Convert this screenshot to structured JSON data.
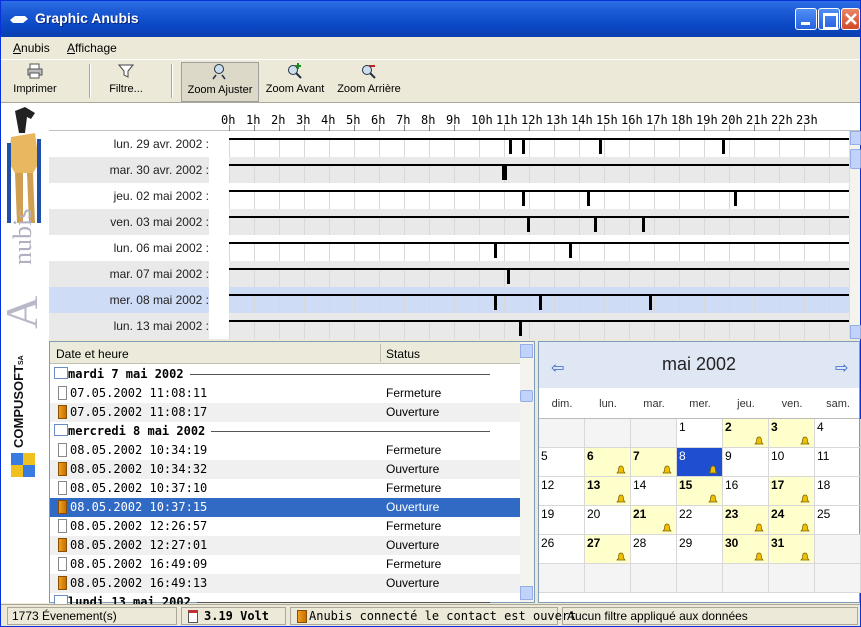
{
  "window": {
    "title": "Graphic Anubis"
  },
  "menu": {
    "anubis": "Anubis",
    "affichage": "Affichage"
  },
  "toolbar": {
    "print": "Imprimer",
    "filter": "Filtre...",
    "zoom_fit": "Zoom Ajuster",
    "zoom_in": "Zoom Avant",
    "zoom_out": "Zoom Arrière"
  },
  "banner": {
    "brand": "nubis",
    "brand_initial": "A",
    "company": "COMPUSOFT",
    "company_suffix": "SA"
  },
  "timeline": {
    "hours": [
      "0h",
      "1h",
      "2h",
      "3h",
      "4h",
      "5h",
      "6h",
      "7h",
      "8h",
      "9h",
      "10h",
      "11h",
      "12h",
      "13h",
      "14h",
      "15h",
      "16h",
      "17h",
      "18h",
      "19h",
      "20h",
      "21h",
      "22h",
      "23h"
    ],
    "rows": [
      {
        "date": "lun. 29 avr. 2002 :",
        "events": [
          11.2,
          11.7,
          14.8,
          19.7
        ]
      },
      {
        "date": "mar. 30 avr. 2002 :",
        "events": [
          10.9,
          11.0
        ]
      },
      {
        "date": "jeu. 02 mai 2002 :",
        "events": [
          11.7,
          14.3,
          20.2
        ]
      },
      {
        "date": "ven. 03 mai 2002 :",
        "events": [
          11.9,
          14.6,
          16.5
        ]
      },
      {
        "date": "lun. 06 mai 2002 :",
        "events": [
          10.6,
          13.6
        ]
      },
      {
        "date": "mar. 07 mai 2002 :",
        "events": [
          11.1
        ]
      },
      {
        "date": "mer. 08 mai 2002 :",
        "events": [
          10.6,
          12.4,
          16.8
        ]
      },
      {
        "date": "lun. 13 mai 2002 :",
        "events": [
          11.6
        ]
      }
    ],
    "selected_row": 6
  },
  "events": {
    "col_date": "Date et heure",
    "col_status": "Status",
    "rows": [
      {
        "type": "group",
        "text": "mardi 7 mai 2002"
      },
      {
        "type": "item",
        "icon": "closed",
        "text": "07.05.2002 11:08:11",
        "status": "Fermeture"
      },
      {
        "type": "item",
        "icon": "open",
        "text": "07.05.2002 11:08:17",
        "status": "Ouverture"
      },
      {
        "type": "group",
        "text": "mercredi 8 mai 2002"
      },
      {
        "type": "item",
        "icon": "closed",
        "text": "08.05.2002 10:34:19",
        "status": "Fermeture"
      },
      {
        "type": "item",
        "icon": "open",
        "text": "08.05.2002 10:34:32",
        "status": "Ouverture"
      },
      {
        "type": "item",
        "icon": "closed",
        "text": "08.05.2002 10:37:10",
        "status": "Fermeture"
      },
      {
        "type": "item",
        "icon": "open",
        "text": "08.05.2002 10:37:15",
        "status": "Ouverture",
        "selected": true
      },
      {
        "type": "item",
        "icon": "closed",
        "text": "08.05.2002 12:26:57",
        "status": "Fermeture"
      },
      {
        "type": "item",
        "icon": "open",
        "text": "08.05.2002 12:27:01",
        "status": "Ouverture"
      },
      {
        "type": "item",
        "icon": "closed",
        "text": "08.05.2002 16:49:09",
        "status": "Fermeture"
      },
      {
        "type": "item",
        "icon": "open",
        "text": "08.05.2002 16:49:13",
        "status": "Ouverture"
      },
      {
        "type": "group",
        "text": "lundi 13 mai 2002"
      }
    ]
  },
  "calendar": {
    "title": "mai 2002",
    "weekdays": [
      "dim.",
      "lun.",
      "mar.",
      "mer.",
      "jeu.",
      "ven.",
      "sam."
    ],
    "weeks": [
      [
        null,
        null,
        null,
        "1",
        "2",
        "3",
        "4"
      ],
      [
        "5",
        "6",
        "7",
        "8",
        "9",
        "10",
        "11"
      ],
      [
        "12",
        "13",
        "14",
        "15",
        "16",
        "17",
        "18"
      ],
      [
        "19",
        "20",
        "21",
        "22",
        "23",
        "24",
        "25"
      ],
      [
        "26",
        "27",
        "28",
        "29",
        "30",
        "31",
        null
      ],
      [
        null,
        null,
        null,
        null,
        null,
        null,
        null
      ]
    ],
    "event_days": [
      "2",
      "3",
      "6",
      "7",
      "8",
      "13",
      "15",
      "17",
      "21",
      "23",
      "24",
      "27",
      "30",
      "31"
    ],
    "selected_day": "8"
  },
  "status": {
    "count": "1773 Évenement(s)",
    "voltage": "3.19 Volt",
    "contact": "Anubis connecté le contact est ouvert",
    "filter": "Aucun filtre appliqué aux données"
  },
  "colors": {
    "title_bar": "#0a47c4",
    "selection": "#316ac5",
    "event_day": "#ffffcc",
    "selected_day": "#1f4fd0"
  }
}
